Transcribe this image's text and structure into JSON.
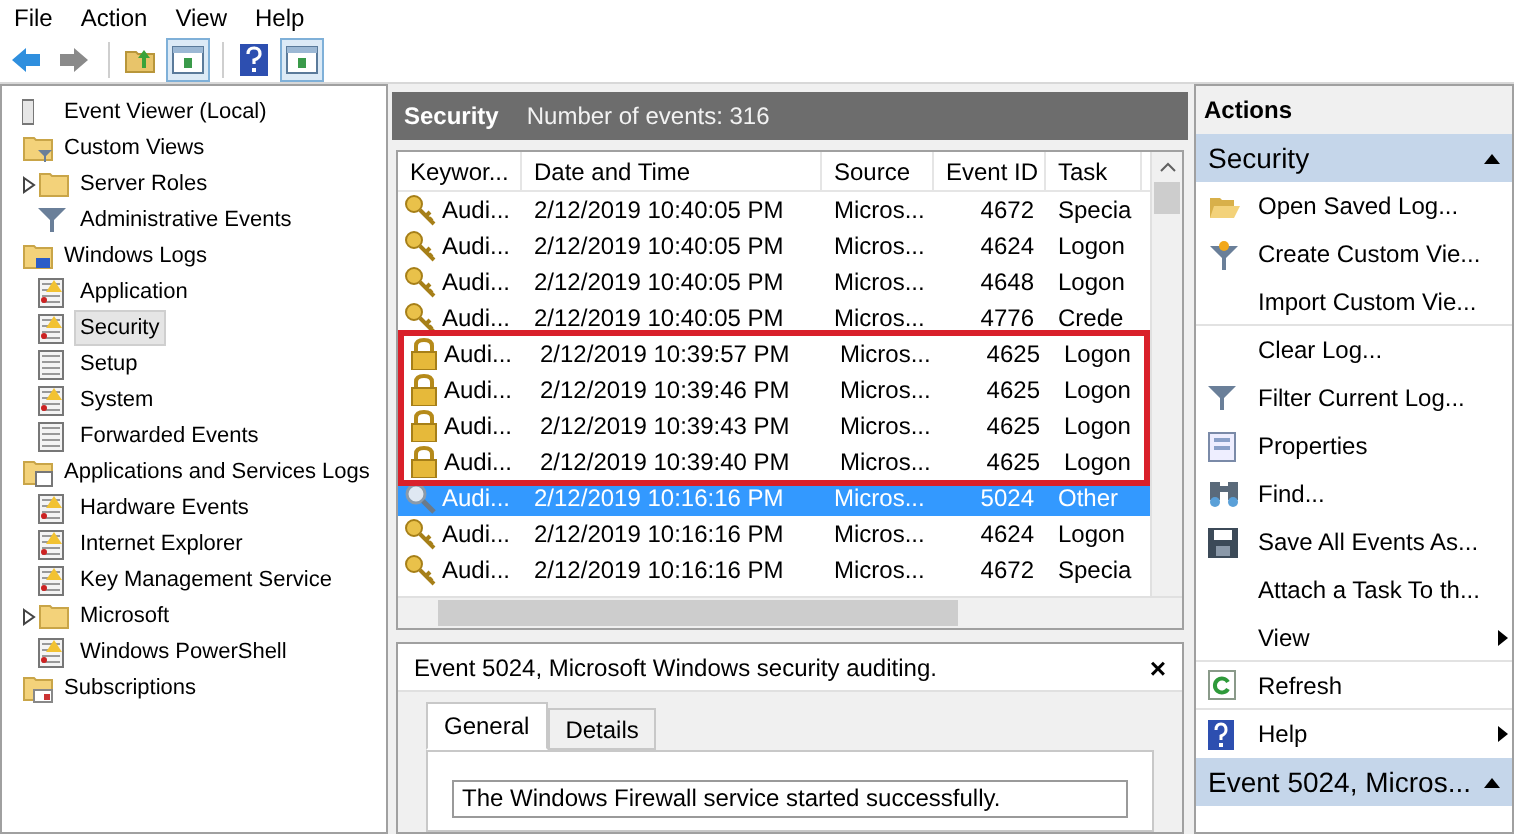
{
  "menu": [
    "File",
    "Action",
    "View",
    "Help"
  ],
  "toolbar": [
    {
      "kind": "back"
    },
    {
      "kind": "forward"
    },
    {
      "kind": "up"
    },
    {
      "kind": "pane",
      "selected": true
    },
    {
      "kind": "help"
    },
    {
      "kind": "pane",
      "selected": true
    }
  ],
  "tree": [
    {
      "label": "Event Viewer (Local)",
      "kind": "viewer",
      "selected": false,
      "children": [
        {
          "label": "Custom Views",
          "kind": "filter-folder",
          "selected": false,
          "children": [
            {
              "label": "Server Roles",
              "kind": "folder",
              "selected": false,
              "collapsed": true
            },
            {
              "label": "Administrative Events",
              "kind": "filter",
              "selected": false
            }
          ]
        },
        {
          "label": "Windows Logs",
          "kind": "pc-folder",
          "selected": false,
          "children": [
            {
              "label": "Application",
              "kind": "log",
              "selected": false
            },
            {
              "label": "Security",
              "kind": "log",
              "selected": true
            },
            {
              "label": "Setup",
              "kind": "plain-log",
              "selected": false
            },
            {
              "label": "System",
              "kind": "log",
              "selected": false
            },
            {
              "label": "Forwarded Events",
              "kind": "plain-log",
              "selected": false
            }
          ]
        },
        {
          "label": "Applications and Services Logs",
          "kind": "window-folder",
          "selected": false,
          "children": [
            {
              "label": "Hardware Events",
              "kind": "log",
              "selected": false
            },
            {
              "label": "Internet Explorer",
              "kind": "log",
              "selected": false
            },
            {
              "label": "Key Management Service",
              "kind": "log",
              "selected": false
            },
            {
              "label": "Microsoft",
              "kind": "folder",
              "selected": false,
              "collapsed": true
            },
            {
              "label": "Windows PowerShell",
              "kind": "log",
              "selected": false
            }
          ]
        },
        {
          "label": "Subscriptions",
          "kind": "sub-folder",
          "selected": false
        }
      ]
    }
  ],
  "log_header": {
    "title": "Security",
    "count": "Number of events: 316"
  },
  "table": {
    "columns": [
      "Keywor...",
      "Date and Time",
      "Source",
      "Event ID",
      "Task"
    ],
    "rows": [
      {
        "kind": "key",
        "keyword": "Audi...",
        "date": "2/12/2019 10:40:05 PM",
        "source": "Micros...",
        "event_id": "4672",
        "task": "Specia",
        "selected": false,
        "highlighted": false
      },
      {
        "kind": "key",
        "keyword": "Audi...",
        "date": "2/12/2019 10:40:05 PM",
        "source": "Micros...",
        "event_id": "4624",
        "task": "Logon",
        "selected": false,
        "highlighted": false
      },
      {
        "kind": "key",
        "keyword": "Audi...",
        "date": "2/12/2019 10:40:05 PM",
        "source": "Micros...",
        "event_id": "4648",
        "task": "Logon",
        "selected": false,
        "highlighted": false
      },
      {
        "kind": "key",
        "keyword": "Audi...",
        "date": "2/12/2019 10:40:05 PM",
        "source": "Micros...",
        "event_id": "4776",
        "task": "Crede",
        "selected": false,
        "highlighted": false
      },
      {
        "kind": "lock",
        "keyword": "Audi...",
        "date": "2/12/2019 10:39:57 PM",
        "source": "Micros...",
        "event_id": "4625",
        "task": "Logon",
        "selected": false,
        "highlighted": true
      },
      {
        "kind": "lock",
        "keyword": "Audi...",
        "date": "2/12/2019 10:39:46 PM",
        "source": "Micros...",
        "event_id": "4625",
        "task": "Logon",
        "selected": false,
        "highlighted": true
      },
      {
        "kind": "lock",
        "keyword": "Audi...",
        "date": "2/12/2019 10:39:43 PM",
        "source": "Micros...",
        "event_id": "4625",
        "task": "Logon",
        "selected": false,
        "highlighted": true
      },
      {
        "kind": "lock",
        "keyword": "Audi...",
        "date": "2/12/2019 10:39:40 PM",
        "source": "Micros...",
        "event_id": "4625",
        "task": "Logon",
        "selected": false,
        "highlighted": true
      },
      {
        "kind": "magnifier",
        "keyword": "Audi...",
        "date": "2/12/2019 10:16:16 PM",
        "source": "Micros...",
        "event_id": "5024",
        "task": "Other",
        "selected": true,
        "highlighted": false
      },
      {
        "kind": "key",
        "keyword": "Audi...",
        "date": "2/12/2019 10:16:16 PM",
        "source": "Micros...",
        "event_id": "4624",
        "task": "Logon",
        "selected": false,
        "highlighted": false
      },
      {
        "kind": "key",
        "keyword": "Audi...",
        "date": "2/12/2019 10:16:16 PM",
        "source": "Micros...",
        "event_id": "4672",
        "task": "Specia",
        "selected": false,
        "highlighted": false
      }
    ]
  },
  "details": {
    "title": "Event 5024, Microsoft Windows security auditing.",
    "close": "×",
    "tabs": [
      {
        "label": "General",
        "selected": true
      },
      {
        "label": "Details",
        "selected": false
      }
    ],
    "text": "The Windows Firewall service started successfully."
  },
  "actions": {
    "title": "Actions",
    "sections": [
      {
        "title": "Security",
        "expanded": true,
        "items": [
          {
            "label": "Open Saved Log...",
            "kind": "open",
            "submenu": false,
            "divider": false
          },
          {
            "label": "Create Custom Vie...",
            "kind": "filter-star",
            "submenu": false,
            "divider": false
          },
          {
            "label": "Import Custom Vie...",
            "kind": "none",
            "submenu": false,
            "divider": true
          },
          {
            "label": "Clear Log...",
            "kind": "none",
            "submenu": false,
            "divider": false
          },
          {
            "label": "Filter Current Log...",
            "kind": "filter",
            "submenu": false,
            "divider": false
          },
          {
            "label": "Properties",
            "kind": "properties",
            "submenu": false,
            "divider": false
          },
          {
            "label": "Find...",
            "kind": "find",
            "submenu": false,
            "divider": false
          },
          {
            "label": "Save All Events As...",
            "kind": "save",
            "submenu": false,
            "divider": false
          },
          {
            "label": "Attach a Task To th...",
            "kind": "none",
            "submenu": false,
            "divider": false
          },
          {
            "label": "View",
            "kind": "none",
            "submenu": true,
            "divider": true
          },
          {
            "label": "Refresh",
            "kind": "refresh",
            "submenu": false,
            "divider": true
          },
          {
            "label": "Help",
            "kind": "help",
            "submenu": true,
            "divider": false
          }
        ]
      },
      {
        "title": "Event 5024, Micros...",
        "expanded": true
      }
    ]
  }
}
